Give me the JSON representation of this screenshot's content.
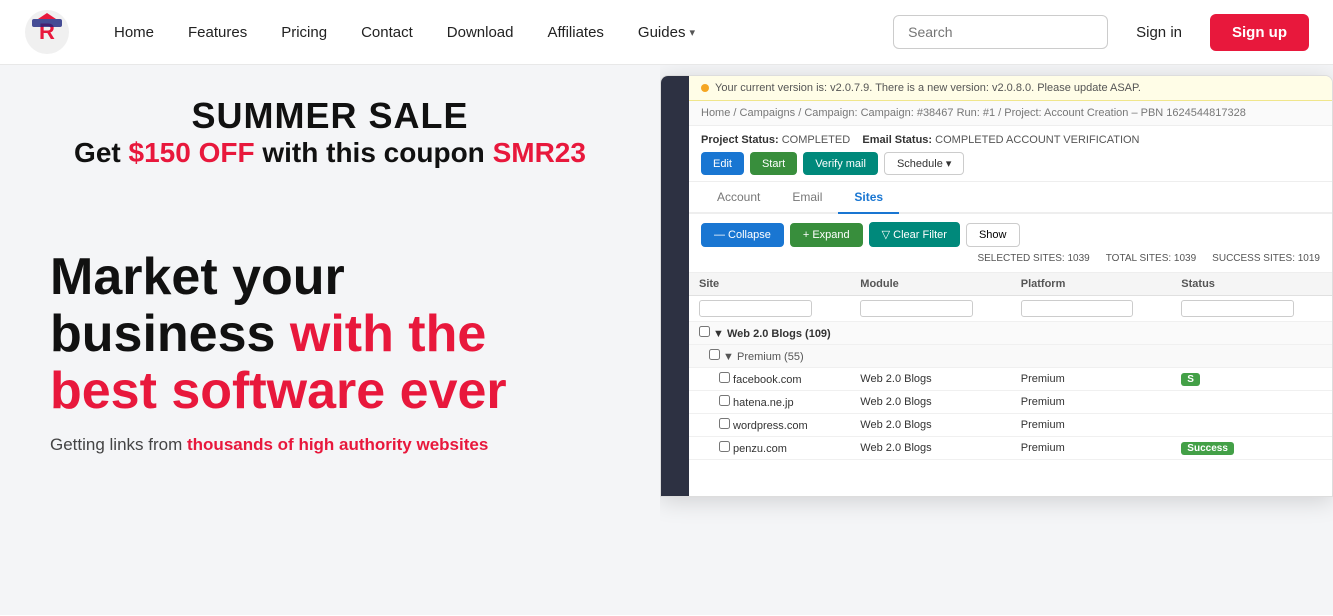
{
  "nav": {
    "links": [
      {
        "label": "Home",
        "id": "home"
      },
      {
        "label": "Features",
        "id": "features"
      },
      {
        "label": "Pricing",
        "id": "pricing"
      },
      {
        "label": "Contact",
        "id": "contact"
      },
      {
        "label": "Download",
        "id": "download"
      },
      {
        "label": "Affiliates",
        "id": "affiliates"
      },
      {
        "label": "Guides",
        "id": "guides",
        "hasDropdown": true
      }
    ],
    "search_placeholder": "Search",
    "signin_label": "Sign in",
    "signup_label": "Sign up"
  },
  "hero": {
    "sale_title": "SUMMER SALE",
    "sale_subtitle_pre": "Get ",
    "sale_amount": "$150 OFF",
    "sale_subtitle_mid": " with this coupon ",
    "sale_coupon": "SMR23",
    "tagline_line1": "Market your",
    "tagline_line2": "business ",
    "tagline_line2_red": "with the",
    "tagline_line3_red": "best software ever",
    "subtext_pre": "Getting links from ",
    "subtext_red": "thousands of high authority websites"
  },
  "app": {
    "update_banner": "Your current version is: v2.0.7.9. There is a new version: v2.0.8.0. Please update ASAP.",
    "breadcrumb": "Home / Campaigns / Campaign: Campaign: #38467 Run: #1 / Project: Account Creation – PBN 1624544817328",
    "status": {
      "project_label": "Project Status:",
      "project_value": "COMPLETED",
      "email_label": "Email Status:",
      "email_value": "COMPLETED ACCOUNT VERIFICATION"
    },
    "action_buttons": [
      "Edit",
      "Start",
      "Verify mail",
      "Schedule ▾"
    ],
    "tabs": [
      "Account",
      "Email",
      "Sites"
    ],
    "active_tab": "Sites",
    "toolbar_buttons": [
      "— Collapse",
      "+ Expand",
      "▽  Clear Filter",
      "Show"
    ],
    "stats": {
      "selected": "SELECTED SITES: 1039",
      "total": "TOTAL SITES: 1039",
      "success": "SUCCESS SITES: 1019"
    },
    "table": {
      "columns": [
        "Site",
        "Module",
        "Platform",
        "Status"
      ],
      "rows": [
        {
          "type": "group",
          "site": "Web 2.0 Blogs (109)",
          "module": "",
          "platform": "",
          "status": ""
        },
        {
          "type": "subgroup",
          "site": "Premium (55)",
          "module": "",
          "platform": "",
          "status": ""
        },
        {
          "type": "data",
          "site": "facebook.com",
          "module": "Web 2.0 Blogs",
          "platform": "Premium",
          "status": "S"
        },
        {
          "type": "data",
          "site": "hatena.ne.jp",
          "module": "Web 2.0 Blogs",
          "platform": "Premium",
          "status": ""
        },
        {
          "type": "data",
          "site": "wordpress.com",
          "module": "Web 2.0 Blogs",
          "platform": "Premium",
          "status": ""
        },
        {
          "type": "data",
          "site": "penzu.com",
          "module": "Web 2.0 Blogs",
          "platform": "Premium",
          "status": "Success"
        }
      ]
    }
  }
}
